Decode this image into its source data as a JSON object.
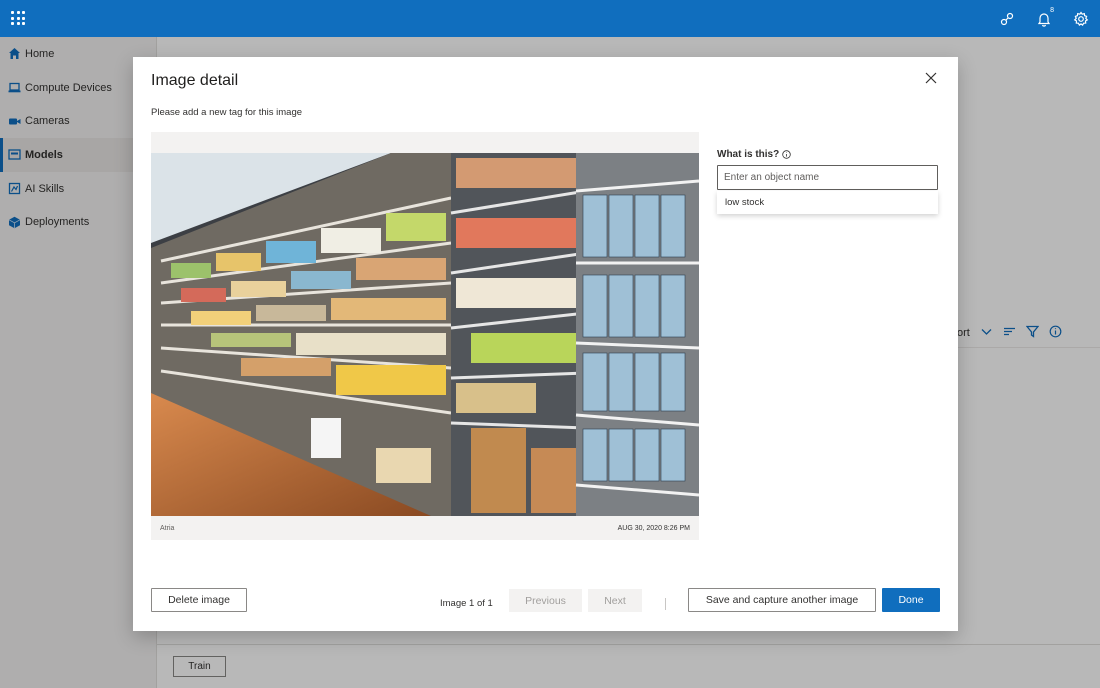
{
  "topbar": {
    "icons": [
      "apps-waffle-icon",
      "share-connect-icon",
      "bell-icon",
      "gear-icon"
    ],
    "notification_count": "8",
    "accent_color": "#106ebe"
  },
  "sidebar": {
    "items": [
      {
        "label": "Home",
        "icon": "home-icon"
      },
      {
        "label": "Compute Devices",
        "icon": "laptop-icon"
      },
      {
        "label": "Cameras",
        "icon": "camera-icon"
      },
      {
        "label": "Models",
        "icon": "model-icon",
        "active": true
      },
      {
        "label": "AI Skills",
        "icon": "ai-skills-icon"
      },
      {
        "label": "Deployments",
        "icon": "deployments-icon"
      }
    ]
  },
  "background": {
    "sort_label": "ort",
    "train_label": "Train"
  },
  "modal": {
    "title": "Image detail",
    "subtitle": "Please add a new tag for this image",
    "image": {
      "location": "Atria",
      "timestamp": "AUG 30, 2020 8:26 PM"
    },
    "tag": {
      "question": "What is this?",
      "placeholder": "Enter an object name",
      "suggestion": "low stock"
    },
    "footer": {
      "delete_label": "Delete image",
      "pager_text": "Image 1 of 1",
      "previous_label": "Previous",
      "next_label": "Next",
      "save_capture_label": "Save and capture another image",
      "done_label": "Done"
    }
  }
}
